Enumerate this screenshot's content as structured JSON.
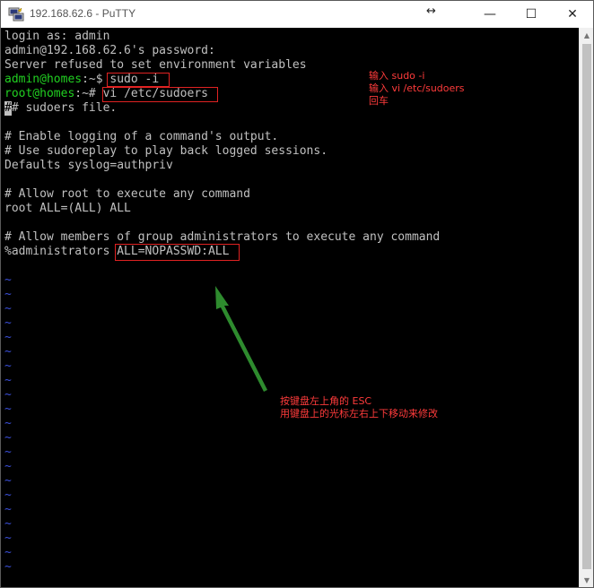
{
  "window": {
    "title": "192.168.62.6 - PuTTY",
    "resize_glyph": "↔",
    "min_glyph": "—",
    "max_glyph": "☐",
    "close_glyph": "✕"
  },
  "terminal": {
    "l1": "login as: admin",
    "l2": "admin@192.168.62.6's password:",
    "l3": "Server refused to set environment variables",
    "l4_user": "admin@homes",
    "l4_rest": ":~$ ",
    "l4_cmd": "sudo -i",
    "l5_user": "root@homes",
    "l5_rest": ":~# ",
    "l5_cmd": "vi /etc/sudoers",
    "l6_cursor": "#",
    "l6_rest": "# sudoers file.",
    "l8": "# Enable logging of a command's output.",
    "l9": "# Use sudoreplay to play back logged sessions.",
    "l10": "Defaults syslog=authpriv",
    "l12": "# Allow root to execute any command",
    "l13": "root ALL=(ALL) ALL",
    "l15": "# Allow members of group administrators to execute any command",
    "l16_a": "%administrators ",
    "l16_b": "ALL=NOPASSWD:ALL",
    "tilde": "~"
  },
  "notes": {
    "top_line1": "输入 sudo -i",
    "top_line2": "输入 vi /etc/sudoers",
    "top_line3": "回车",
    "bottom_line1": "按键盘左上角的 ESC",
    "bottom_line2": "用键盘上的光标左右上下移动来修改"
  },
  "colors": {
    "terminal_bg": "#000000",
    "terminal_fg": "#c0c0c0",
    "prompt_green": "#21d021",
    "tilde_blue": "#3a4ed8",
    "annotation_red": "#ff3b3b",
    "arrow_green": "#2e8b2e"
  }
}
